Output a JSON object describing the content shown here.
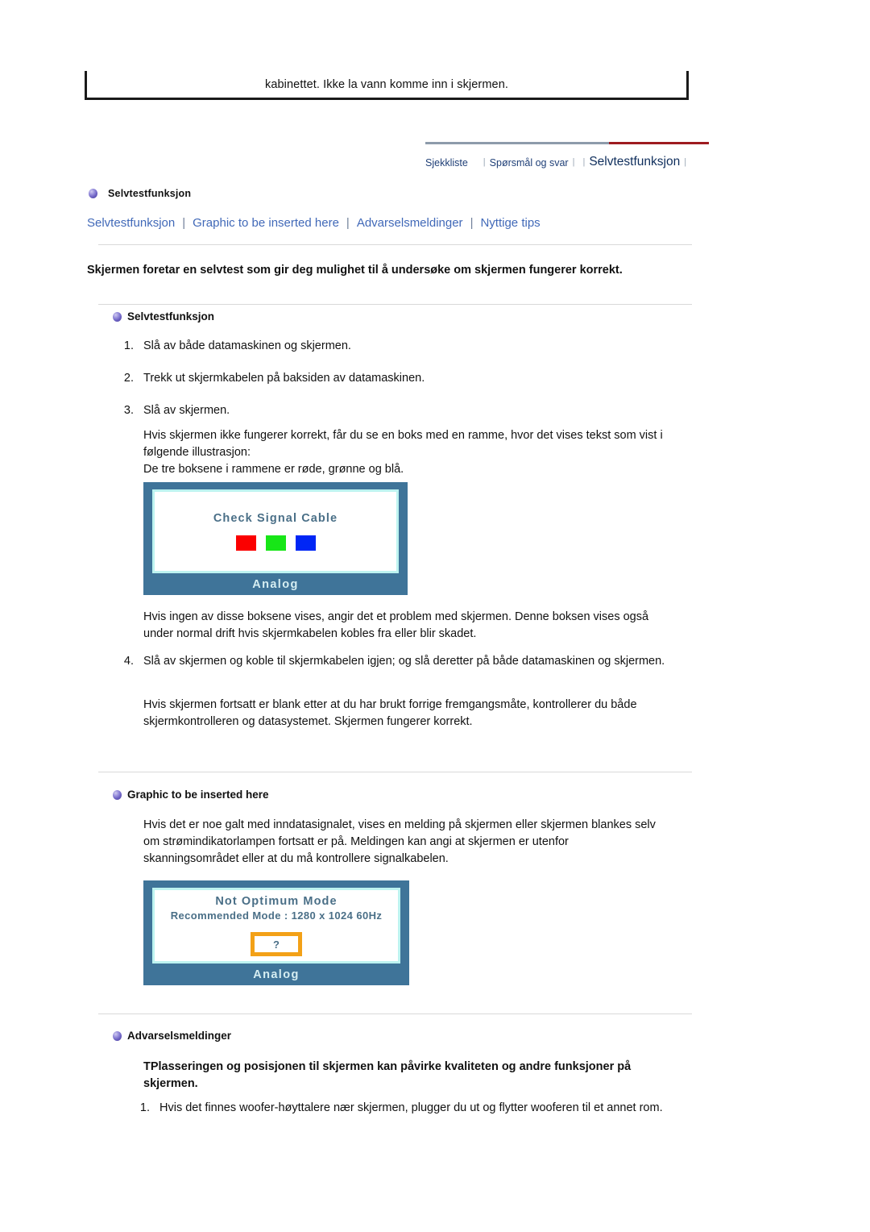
{
  "top_box": {
    "text": "kabinettet. Ikke la vann komme inn i skjermen."
  },
  "tabs": [
    {
      "label": "Sjekkliste",
      "active": false
    },
    {
      "label": "Spørsmål og svar",
      "active": false
    },
    {
      "label": "Selvtestfunksjon",
      "active": true
    }
  ],
  "tab_separator": "|",
  "colors": {
    "rule_grey": "#8d9bab",
    "rule_red": "#9e1b20",
    "link_blue": "#4169b8",
    "monitor_frame": "#3f7499",
    "monitor_inner_glow": "#bdf3f0",
    "osd_text": "#4a6f87",
    "square_red": "#fb0000",
    "square_green": "#17e617",
    "square_blue": "#0026f5",
    "qbox_orange": "#f3a117",
    "bullet_purple": "#6a5fc0"
  },
  "page_head": {
    "icon": "sphere-bullet-icon",
    "label": "Selvtestfunksjon"
  },
  "subnav": {
    "links": [
      "Selvtestfunksjon",
      "Graphic to be inserted here",
      "Advarselsmeldinger",
      "Nyttige tips"
    ],
    "divider": "|"
  },
  "lead": "Skjermen foretar en selvtest som gir deg mulighet til å undersøke om skjermen fungerer korrekt.",
  "sections": {
    "selftest": {
      "heading": "Selvtestfunksjon",
      "steps": [
        {
          "num": "1.",
          "text": "Slå av både datamaskinen og skjermen."
        },
        {
          "num": "2.",
          "text": "Trekk ut skjermkabelen på baksiden av datamaskinen."
        },
        {
          "num": "3.",
          "text": "Slå av skjermen."
        }
      ],
      "note_a": "Hvis skjermen ikke fungerer korrekt, får du se en boks med en ramme, hvor det vises tekst som vist i følgende illustrasjon:\nDe tre boksene i rammene er røde, grønne og blå.",
      "note_b": "Hvis ingen av disse boksene vises, angir det et problem med skjermen. Denne boksen vises også under normal drift hvis skjermkabelen kobles fra eller blir skadet.",
      "step4": {
        "num": "4.",
        "text": "Slå av skjermen og koble til skjermkabelen igjen; og slå deretter på både datamaskinen og skjermen."
      },
      "note_c": "Hvis skjermen fortsatt er blank etter at du har brukt forrige fremgangsmåte, kontrollerer du både skjermkontrolleren og datasystemet. Skjermen fungerer korrekt."
    },
    "graphic": {
      "heading": "Graphic to be inserted here",
      "paragraph": "Hvis det er noe galt med inndatasignalet, vises en melding på skjermen eller skjermen blankes selv om strømindikatorlampen fortsatt er på. Meldingen kan angi at skjermen er utenfor skanningsområdet eller at du må kontrollere signalkabelen."
    },
    "warnings": {
      "heading": "Advarselsmeldinger",
      "subheading": "TPlasseringen og posisjonen til skjermen kan påvirke kvaliteten og andre funksjoner på skjermen.",
      "items": [
        {
          "num": "1.",
          "text": "Hvis det finnes woofer-høyttalere nær skjermen, plugger du ut og flytter wooferen til et annet rom."
        }
      ]
    }
  },
  "monitor_one": {
    "title": "Check Signal Cable",
    "squares": [
      "red",
      "green",
      "blue"
    ],
    "footer": "Analog"
  },
  "monitor_two": {
    "title": "Not Optimum Mode",
    "subtitle": "Recommended Mode : 1280 x 1024  60Hz",
    "question_mark": "?",
    "footer": "Analog"
  }
}
